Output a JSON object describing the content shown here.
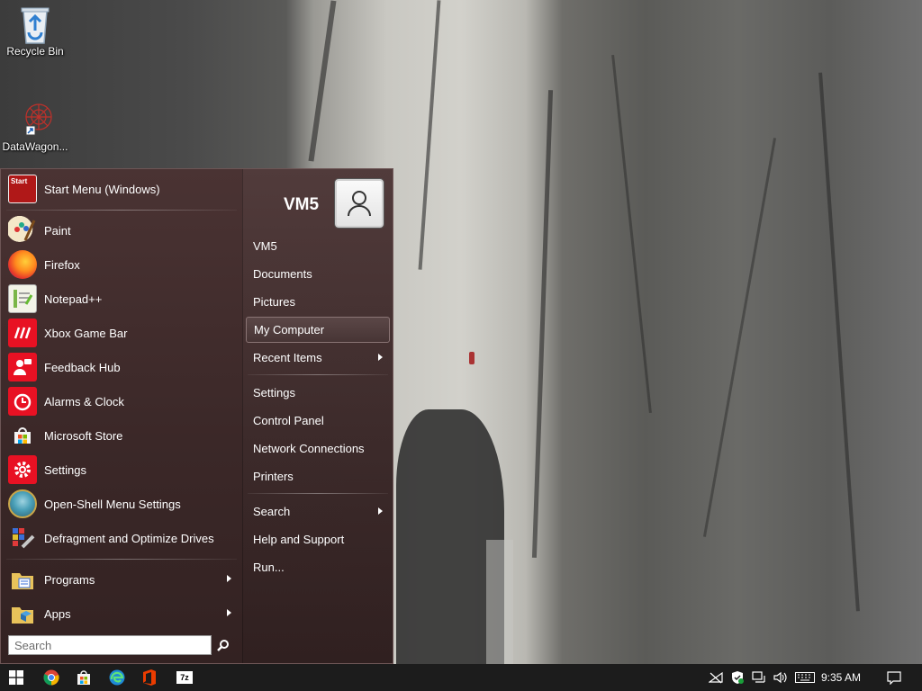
{
  "desktop": {
    "icons": [
      {
        "label": "Recycle Bin",
        "icon": "recycle-bin-icon"
      },
      {
        "label": "DataWagon...",
        "icon": "datawagon-shortcut-icon"
      }
    ]
  },
  "start_menu": {
    "header": {
      "label": "Start Menu (Windows)",
      "badge": "Start"
    },
    "pinned": [
      {
        "label": "Paint",
        "icon": "paint-icon"
      },
      {
        "label": "Firefox",
        "icon": "firefox-icon"
      },
      {
        "label": "Notepad++",
        "icon": "notepadpp-icon"
      },
      {
        "label": "Xbox Game Bar",
        "icon": "xbox-game-bar-icon"
      },
      {
        "label": "Feedback Hub",
        "icon": "feedback-hub-icon"
      },
      {
        "label": "Alarms & Clock",
        "icon": "alarms-clock-icon"
      },
      {
        "label": "Microsoft Store",
        "icon": "microsoft-store-icon"
      },
      {
        "label": "Settings",
        "icon": "settings-gear-icon"
      },
      {
        "label": "Open-Shell Menu Settings",
        "icon": "open-shell-icon"
      },
      {
        "label": "Defragment and Optimize Drives",
        "icon": "defrag-icon"
      }
    ],
    "programs": {
      "label": "Programs",
      "icon": "programs-folder-icon"
    },
    "apps": {
      "label": "Apps",
      "icon": "apps-folder-icon"
    },
    "search": {
      "placeholder": "Search"
    },
    "user": {
      "name": "VM5"
    },
    "right_items": [
      {
        "label": "VM5"
      },
      {
        "label": "Documents"
      },
      {
        "label": "Pictures"
      },
      {
        "label": "My Computer",
        "highlighted": true
      },
      {
        "label": "Recent Items",
        "submenu": true
      },
      {
        "label": "Settings"
      },
      {
        "label": "Control Panel"
      },
      {
        "label": "Network Connections"
      },
      {
        "label": "Printers"
      },
      {
        "label": "Search",
        "submenu": true
      },
      {
        "label": "Help and Support"
      },
      {
        "label": "Run..."
      }
    ]
  },
  "taskbar": {
    "pinned": [
      "windows-start-icon",
      "chrome-icon",
      "store-icon",
      "edge-icon",
      "office-icon",
      "7zip-icon"
    ],
    "seven_zip_label": "7z",
    "tray": [
      "network-offline-icon",
      "defender-shield-icon",
      "ethernet-icon",
      "volume-icon",
      "keyboard-icon"
    ],
    "clock": "9:35 AM"
  }
}
